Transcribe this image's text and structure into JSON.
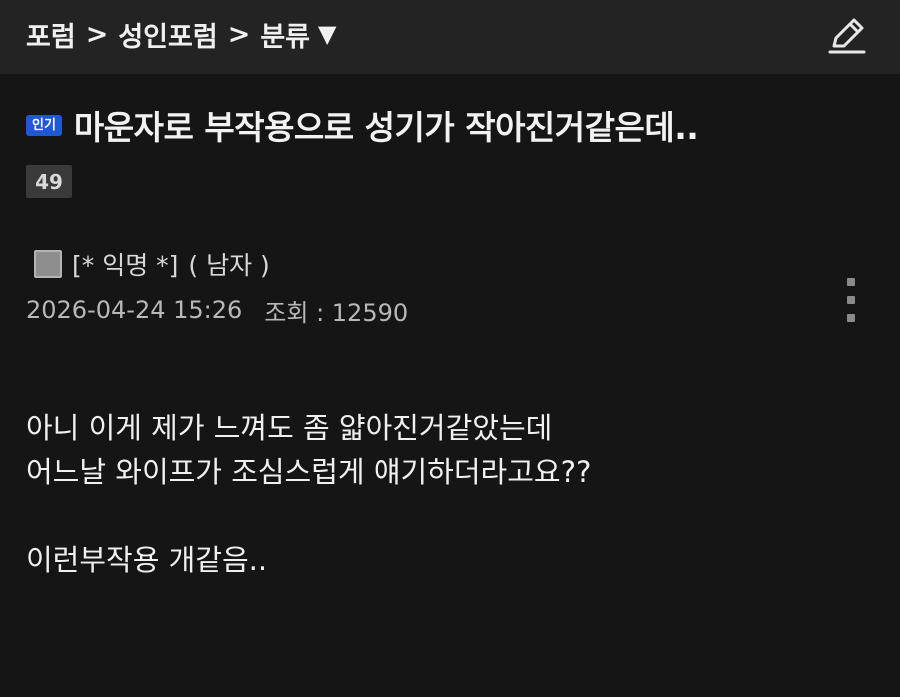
{
  "header": {
    "breadcrumb": [
      "포럼",
      "성인포럼",
      "분류"
    ],
    "separator": ">",
    "dropdown_caret": "▼",
    "write_icon": "pencil-edit-icon"
  },
  "post": {
    "badge": "인기",
    "title": "마운자로 부작용으로 성기가 작아진거같은데..",
    "comment_count": "49",
    "author": {
      "avatar_icon": "square-avatar-icon",
      "name": "[* 익명 *]",
      "gender": "( 남자 )"
    },
    "date": "2026-04-24 15:26",
    "views_label": "조회 : 12590",
    "more_icon": "vertical-dots-icon",
    "body": [
      "아니 이게 제가 느껴도 좀 얇아진거같았는데",
      "어느날 와이프가 조심스럽게 얘기하더라고요??",
      "",
      "이런부작용 개같음.."
    ]
  },
  "colors": {
    "background": "#151515",
    "header_bg": "#232323",
    "badge_blue": "#1f58d6"
  }
}
